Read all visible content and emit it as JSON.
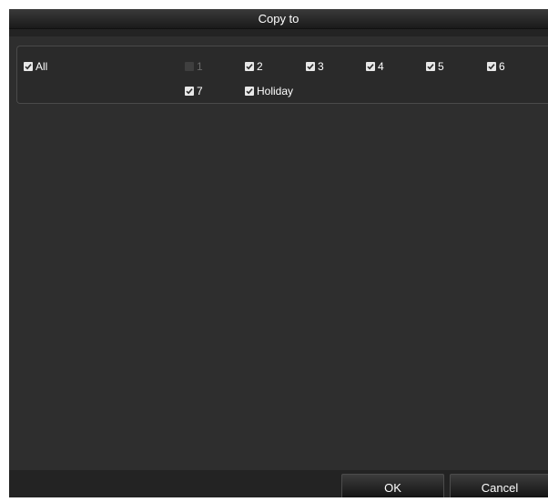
{
  "dialog": {
    "title": "Copy to"
  },
  "checkboxes": {
    "all": {
      "label": "All",
      "checked": true,
      "enabled": true
    },
    "ch1": {
      "label": "1",
      "checked": false,
      "enabled": false
    },
    "ch2": {
      "label": "2",
      "checked": true,
      "enabled": true
    },
    "ch3": {
      "label": "3",
      "checked": true,
      "enabled": true
    },
    "ch4": {
      "label": "4",
      "checked": true,
      "enabled": true
    },
    "ch5": {
      "label": "5",
      "checked": true,
      "enabled": true
    },
    "ch6": {
      "label": "6",
      "checked": true,
      "enabled": true
    },
    "ch7": {
      "label": "7",
      "checked": true,
      "enabled": true
    },
    "holiday": {
      "label": "Holiday",
      "checked": true,
      "enabled": true
    }
  },
  "buttons": {
    "ok": "OK",
    "cancel": "Cancel"
  },
  "colors": {
    "dialog_bg": "#2e2e2e",
    "checkbox_fill": "#e8e8e8",
    "disabled_text": "#6a6a6a"
  }
}
